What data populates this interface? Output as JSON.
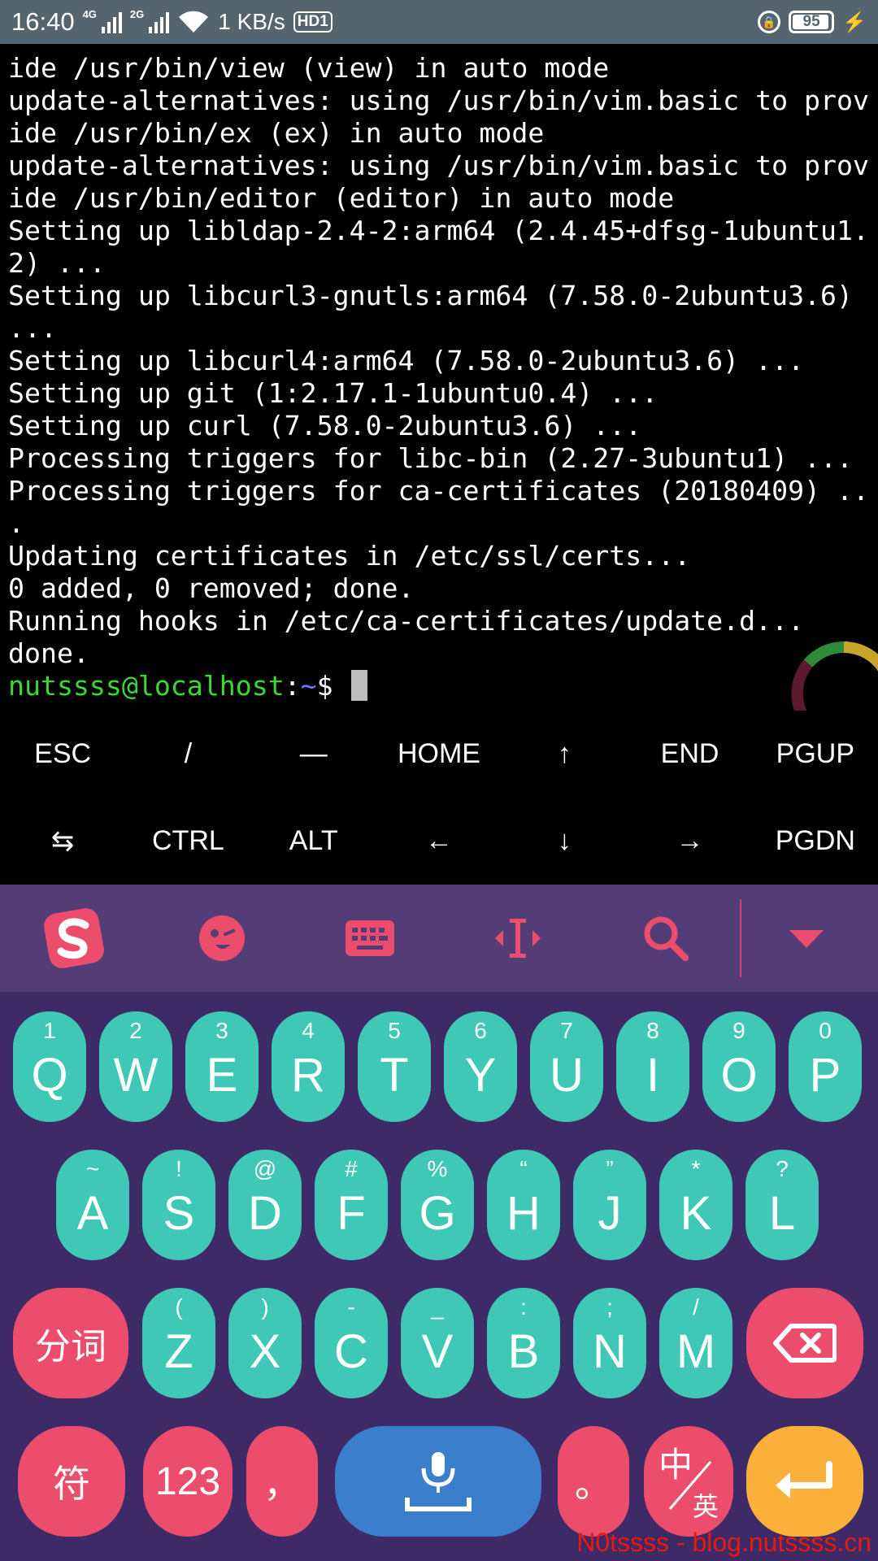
{
  "status_bar": {
    "time": "16:40",
    "network1": "4G",
    "network2": "2G",
    "speed": "1 KB/s",
    "hd": "HD1",
    "battery": "95",
    "battery_level": 0.95
  },
  "terminal": {
    "lines": [
      "ide /usr/bin/view (view) in auto mode",
      "update-alternatives: using /usr/bin/vim.basic to prov",
      "ide /usr/bin/ex (ex) in auto mode",
      "update-alternatives: using /usr/bin/vim.basic to prov",
      "ide /usr/bin/editor (editor) in auto mode",
      "Setting up libldap-2.4-2:arm64 (2.4.45+dfsg-1ubuntu1.",
      "2) ...",
      "Setting up libcurl3-gnutls:arm64 (7.58.0-2ubuntu3.6)",
      "...",
      "Setting up libcurl4:arm64 (7.58.0-2ubuntu3.6) ...",
      "Setting up git (1:2.17.1-1ubuntu0.4) ...",
      "Setting up curl (7.58.0-2ubuntu3.6) ...",
      "Processing triggers for libc-bin (2.27-3ubuntu1) ...",
      "Processing triggers for ca-certificates (20180409) ..",
      ".",
      "Updating certificates in /etc/ssl/certs...",
      "0 added, 0 removed; done.",
      "Running hooks in /etc/ca-certificates/update.d...",
      "done."
    ],
    "prompt_user": "nutssss@localhost",
    "prompt_colon": ":",
    "prompt_path": "~",
    "prompt_symbol": "$ "
  },
  "extra_keys": {
    "row1": [
      "ESC",
      "/",
      "—",
      "HOME",
      "↑",
      "END",
      "PGUP"
    ],
    "row2": [
      "⇆",
      "CTRL",
      "ALT",
      "←",
      "↓",
      "→",
      "PGDN"
    ]
  },
  "keyboard": {
    "row1": [
      {
        "main": "Q",
        "sub": "1"
      },
      {
        "main": "W",
        "sub": "2"
      },
      {
        "main": "E",
        "sub": "3"
      },
      {
        "main": "R",
        "sub": "4"
      },
      {
        "main": "T",
        "sub": "5"
      },
      {
        "main": "Y",
        "sub": "6"
      },
      {
        "main": "U",
        "sub": "7"
      },
      {
        "main": "I",
        "sub": "8"
      },
      {
        "main": "O",
        "sub": "9"
      },
      {
        "main": "P",
        "sub": "0"
      }
    ],
    "row2": [
      {
        "main": "A",
        "sub": "~"
      },
      {
        "main": "S",
        "sub": "!"
      },
      {
        "main": "D",
        "sub": "@"
      },
      {
        "main": "F",
        "sub": "#"
      },
      {
        "main": "G",
        "sub": "%"
      },
      {
        "main": "H",
        "sub": "“"
      },
      {
        "main": "J",
        "sub": "”"
      },
      {
        "main": "K",
        "sub": "*"
      },
      {
        "main": "L",
        "sub": "?"
      }
    ],
    "row3": [
      {
        "main": "Z",
        "sub": "("
      },
      {
        "main": "X",
        "sub": ")"
      },
      {
        "main": "C",
        "sub": "-"
      },
      {
        "main": "V",
        "sub": "_"
      },
      {
        "main": "B",
        "sub": ":"
      },
      {
        "main": "N",
        "sub": ";"
      },
      {
        "main": "M",
        "sub": "/"
      }
    ],
    "fenci": "分词",
    "fu": "符",
    "num": "123",
    "comma": "，",
    "period": "。",
    "lang_zh": "中",
    "lang_en": "英",
    "colors": {
      "letter": "#3fc8b6",
      "function": "#ec4d6d",
      "space": "#3b7fcc",
      "enter": "#fbb03b",
      "background": "#3d2a67",
      "toolbar": "#543d76"
    }
  },
  "watermark": "N0tssss - blog.nutssss.cn"
}
